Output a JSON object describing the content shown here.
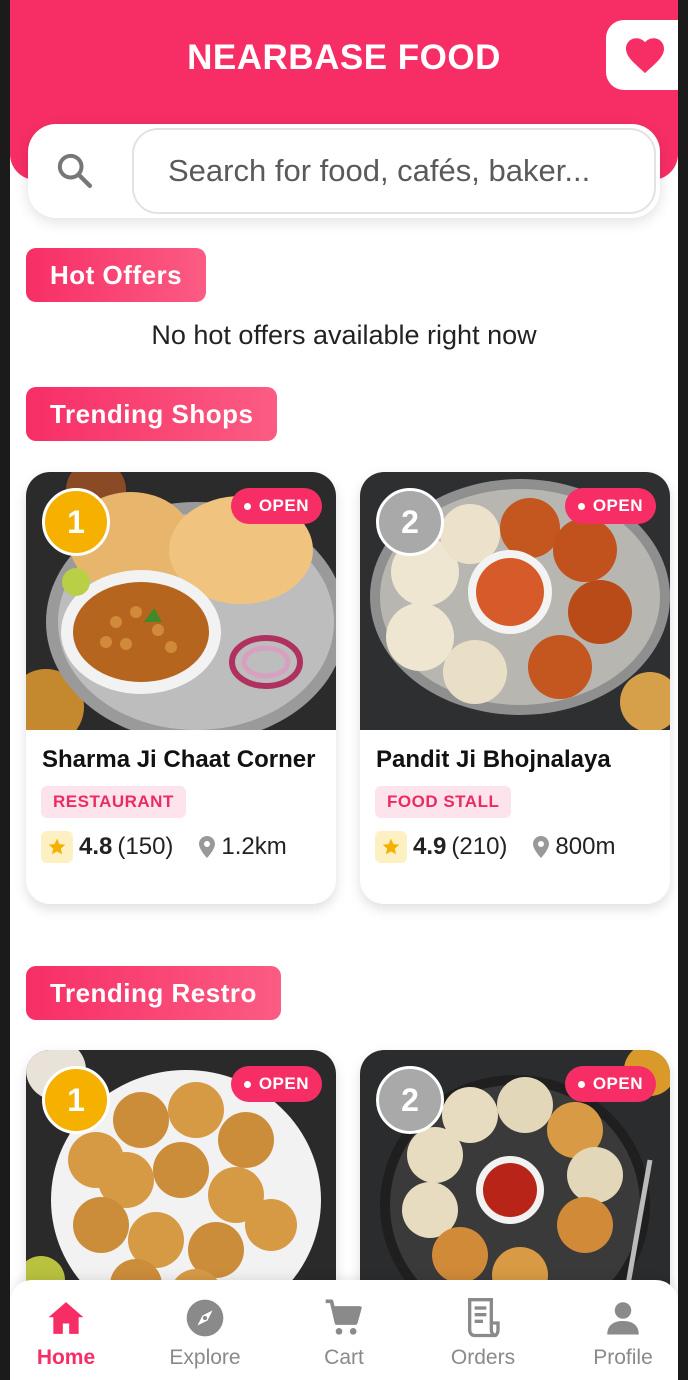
{
  "app": {
    "title": "NEARBASE FOOD"
  },
  "search": {
    "placeholder": "Search for food, cafés, baker..."
  },
  "hot_offers": {
    "title": "Hot Offers",
    "empty_message": "No hot offers available right now"
  },
  "trending_shops": {
    "title": "Trending Shops",
    "items": [
      {
        "rank": "1",
        "status": "OPEN",
        "name": "Sharma Ji Chaat Corner",
        "type": "RESTAURANT",
        "rating": "4.8",
        "reviews": "(150)",
        "distance": "1.2km",
        "image": "chole-bhature-plate"
      },
      {
        "rank": "2",
        "status": "OPEN",
        "name": "Pandit Ji Bhojnalaya",
        "type": "FOOD STALL",
        "rating": "4.9",
        "reviews": "(210)",
        "distance": "800m",
        "image": "momos-plate"
      }
    ]
  },
  "trending_restro": {
    "title": "Trending Restro",
    "items": [
      {
        "rank": "1",
        "status": "OPEN",
        "image": "pani-puri-plate"
      },
      {
        "rank": "2",
        "status": "OPEN",
        "image": "fried-momos-plate"
      }
    ]
  },
  "bottom_nav": {
    "items": [
      {
        "label": "Home",
        "icon": "home-icon",
        "active": true
      },
      {
        "label": "Explore",
        "icon": "compass-icon",
        "active": false
      },
      {
        "label": "Cart",
        "icon": "cart-icon",
        "active": false
      },
      {
        "label": "Orders",
        "icon": "receipt-icon",
        "active": false
      },
      {
        "label": "Profile",
        "icon": "user-icon",
        "active": false
      }
    ]
  },
  "colors": {
    "primary": "#f72e66",
    "rank_gold": "#f6b100",
    "rank_silver": "#a9a9a9",
    "tag_bg": "#fde4ec",
    "star": "#f6b100"
  }
}
